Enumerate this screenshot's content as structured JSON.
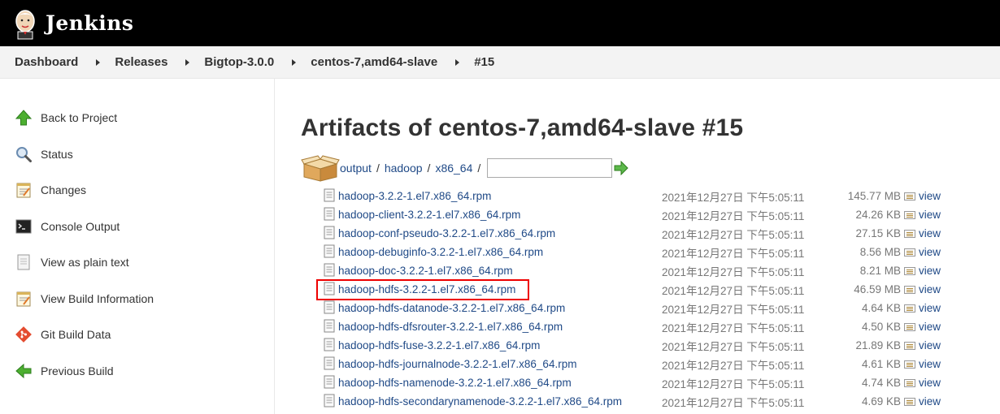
{
  "header": {
    "brand": "Jenkins"
  },
  "breadcrumb": [
    "Dashboard",
    "Releases",
    "Bigtop-3.0.0",
    "centos-7,amd64-slave",
    "#15"
  ],
  "sidebar": {
    "items": [
      {
        "label": "Back to Project",
        "icon": "up-arrow-icon"
      },
      {
        "label": "Status",
        "icon": "magnifier-icon"
      },
      {
        "label": "Changes",
        "icon": "notepad-icon"
      },
      {
        "label": "Console Output",
        "icon": "terminal-icon"
      },
      {
        "label": "View as plain text",
        "icon": "document-icon"
      },
      {
        "label": "View Build Information",
        "icon": "notepad-icon"
      },
      {
        "label": "Git Build Data",
        "icon": "git-icon"
      },
      {
        "label": "Previous Build",
        "icon": "left-arrow-icon"
      }
    ]
  },
  "main": {
    "title": "Artifacts of centos-7,amd64-slave #15",
    "path": [
      "output",
      "hadoop",
      "x86_64"
    ],
    "path_input": "",
    "view_label": "view",
    "files": [
      {
        "name": "hadoop-3.2.2-1.el7.x86_64.rpm",
        "date": "2021年12月27日 下午5:05:11",
        "size": "145.77 MB"
      },
      {
        "name": "hadoop-client-3.2.2-1.el7.x86_64.rpm",
        "date": "2021年12月27日 下午5:05:11",
        "size": "24.26 KB"
      },
      {
        "name": "hadoop-conf-pseudo-3.2.2-1.el7.x86_64.rpm",
        "date": "2021年12月27日 下午5:05:11",
        "size": "27.15 KB"
      },
      {
        "name": "hadoop-debuginfo-3.2.2-1.el7.x86_64.rpm",
        "date": "2021年12月27日 下午5:05:11",
        "size": "8.56 MB"
      },
      {
        "name": "hadoop-doc-3.2.2-1.el7.x86_64.rpm",
        "date": "2021年12月27日 下午5:05:11",
        "size": "8.21 MB"
      },
      {
        "name": "hadoop-hdfs-3.2.2-1.el7.x86_64.rpm",
        "date": "2021年12月27日 下午5:05:11",
        "size": "46.59 MB",
        "highlighted": true
      },
      {
        "name": "hadoop-hdfs-datanode-3.2.2-1.el7.x86_64.rpm",
        "date": "2021年12月27日 下午5:05:11",
        "size": "4.64 KB"
      },
      {
        "name": "hadoop-hdfs-dfsrouter-3.2.2-1.el7.x86_64.rpm",
        "date": "2021年12月27日 下午5:05:11",
        "size": "4.50 KB"
      },
      {
        "name": "hadoop-hdfs-fuse-3.2.2-1.el7.x86_64.rpm",
        "date": "2021年12月27日 下午5:05:11",
        "size": "21.89 KB"
      },
      {
        "name": "hadoop-hdfs-journalnode-3.2.2-1.el7.x86_64.rpm",
        "date": "2021年12月27日 下午5:05:11",
        "size": "4.61 KB"
      },
      {
        "name": "hadoop-hdfs-namenode-3.2.2-1.el7.x86_64.rpm",
        "date": "2021年12月27日 下午5:05:11",
        "size": "4.74 KB"
      },
      {
        "name": "hadoop-hdfs-secondarynamenode-3.2.2-1.el7.x86_64.rpm",
        "date": "2021年12月27日 下午5:05:11",
        "size": "4.69 KB"
      }
    ]
  },
  "colors": {
    "link": "#204a87",
    "header_bg": "#000000",
    "highlight": "#ee0000"
  }
}
